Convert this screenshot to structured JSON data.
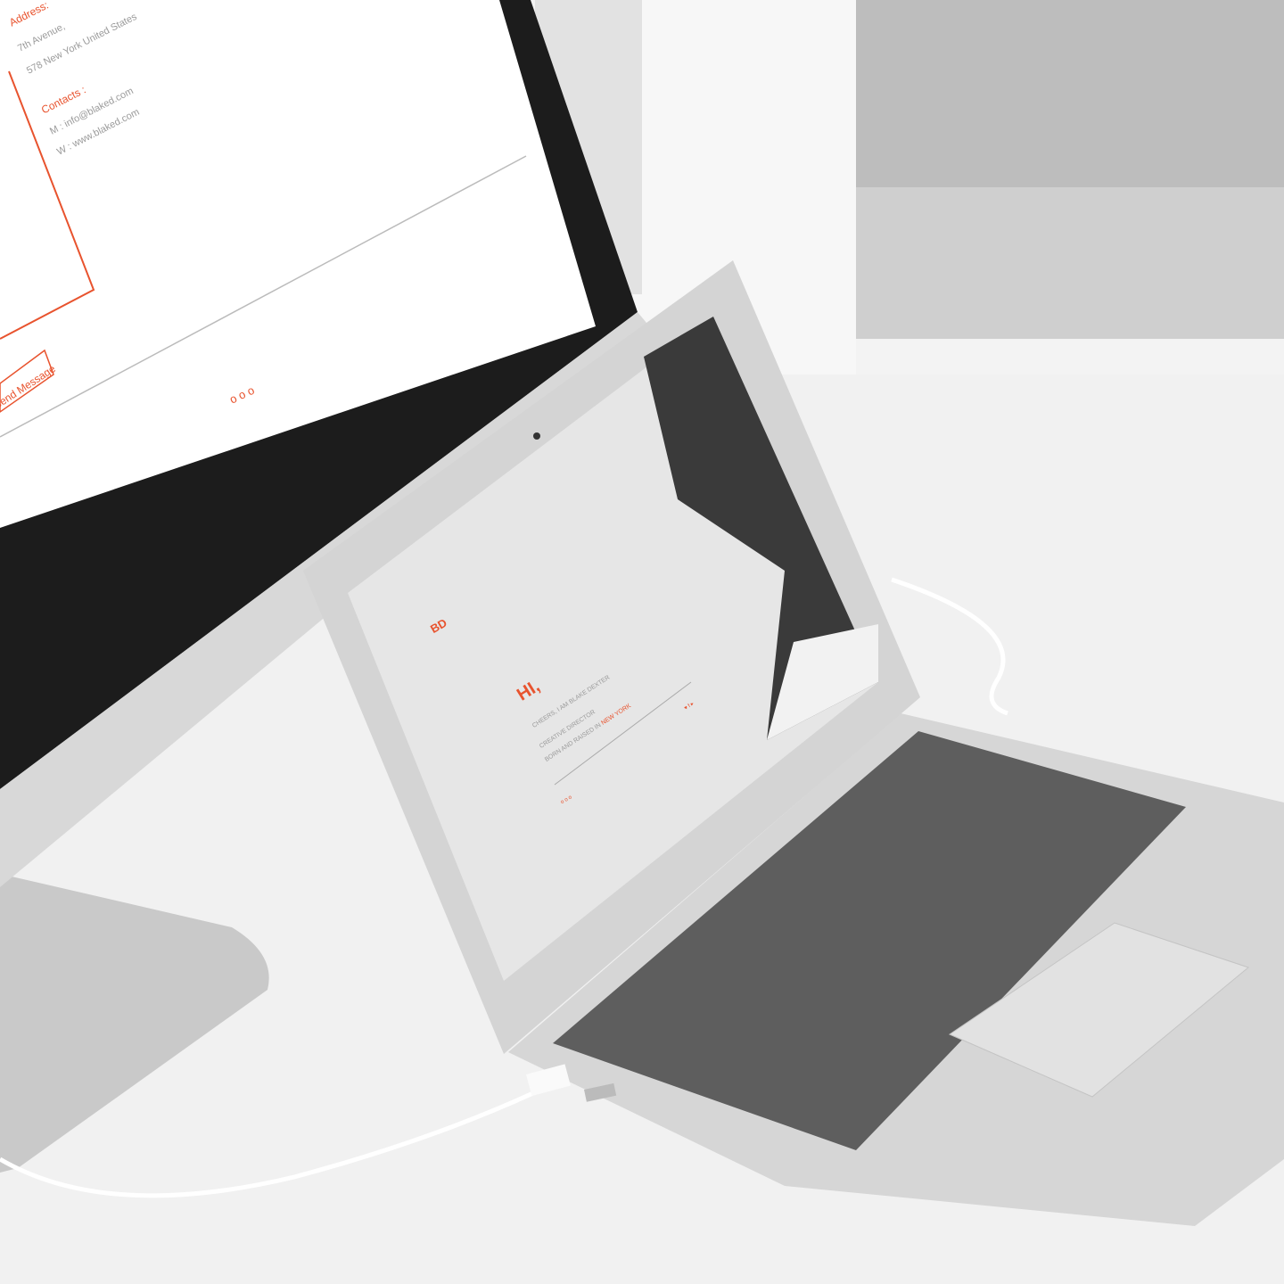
{
  "monitor_site": {
    "address_label": "Address:",
    "address_line1": "7th Avenue,",
    "address_line2": "578 New York United States",
    "contacts_label": "Contacts :",
    "email": "M : info@blaked.com",
    "web": "W : www.blaked.com",
    "send_button": "Send Message",
    "pager": "o o o"
  },
  "laptop_site": {
    "logo": "BD",
    "greeting": "HI,",
    "intro": "CHEERS, I AM BLAKE DEXTER",
    "role": "CREATIVE DIRECTOR",
    "origin_prefix": "BORN AND RAISED IN ",
    "origin_city": "NEW YORK",
    "social": "♥ f ▸",
    "pager": "o o o"
  },
  "colors": {
    "accent": "#e8532e",
    "bezel": "#1c1c1c",
    "aluminum": "#d9d9d9"
  }
}
